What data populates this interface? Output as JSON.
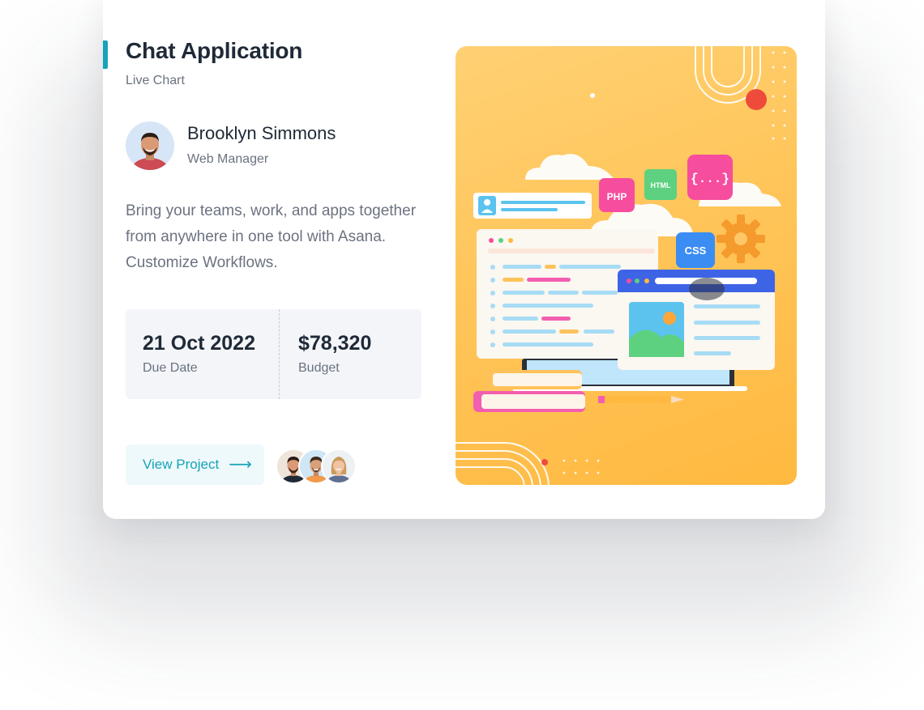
{
  "project": {
    "title": "Chat Application",
    "subtitle": "Live Chart",
    "accent_color": "#17a2b8"
  },
  "manager": {
    "name": "Brooklyn Simmons",
    "role": "Web Manager"
  },
  "description": "Bring your teams, work, and apps together from anywhere in one tool with Asana. Customize Workflows.",
  "stats": {
    "due_date_value": "21 Oct 2022",
    "due_date_label": "Due Date",
    "budget_value": "$78,320",
    "budget_label": "Budget"
  },
  "actions": {
    "view_project_label": "View Project",
    "arrow_glyph": "⟶"
  },
  "illustration": {
    "badges": {
      "php": "PHP",
      "html": "HTML",
      "css": "CSS",
      "braces": "{...}"
    },
    "background_color": "#ffc55a"
  },
  "icons": {
    "arrow": "arrow-right-icon",
    "gear": "gear-icon",
    "image": "image-icon",
    "user": "user-icon"
  }
}
